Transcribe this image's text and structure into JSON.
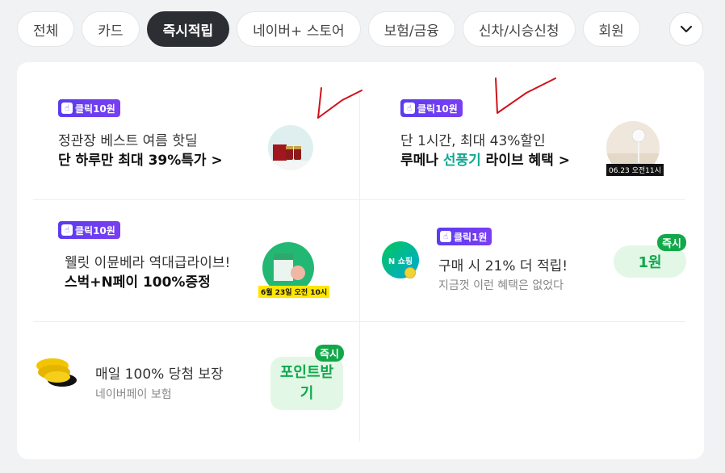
{
  "tabs": [
    {
      "label": "전체",
      "active": false
    },
    {
      "label": "카드",
      "active": false
    },
    {
      "label": "즉시적립",
      "active": true
    },
    {
      "label": "네이버+ 스토어",
      "active": false
    },
    {
      "label": "보험/금융",
      "active": false
    },
    {
      "label": "신차/시승신청",
      "active": false
    },
    {
      "label": "회원",
      "active": false
    }
  ],
  "cards": {
    "ginseng": {
      "badge": "클릭10원",
      "line1": "정관장 베스트 여름 핫딜",
      "line2": "단 하루만 최대 39%특가 >"
    },
    "fan": {
      "badge": "클릭10원",
      "line1": "단 1시간, 최대 43%할인",
      "line2_pre": "루메나 ",
      "line2_accent": "선풍기",
      "line2_post": " 라이브 혜택 >",
      "thumb_caption": "06.23 오전11시"
    },
    "wellit": {
      "badge": "클릭10원",
      "line1": "웰릿 이뮨베라 역대급라이브!",
      "line2": "스벅+N페이 100%증정",
      "thumb_caption": "6월 23일 오전 10시"
    },
    "shopping": {
      "badge": "클릭1원",
      "line1": "구매 시 21% 더 적립!",
      "sub": "지금껏 이런 혜택은 없었다",
      "icon_text": "N 쇼핑",
      "pill": "1원",
      "instant": "즉시"
    },
    "insurance": {
      "line1": "매일 100% 당첨 보장",
      "sub": "네이버페이 보험",
      "pill": "포인트받기",
      "instant": "즉시"
    }
  },
  "colors": {
    "accent": "#11a891",
    "badge": "#6b3ef0",
    "green": "#0fa94c",
    "annotation": "#d0111b"
  }
}
